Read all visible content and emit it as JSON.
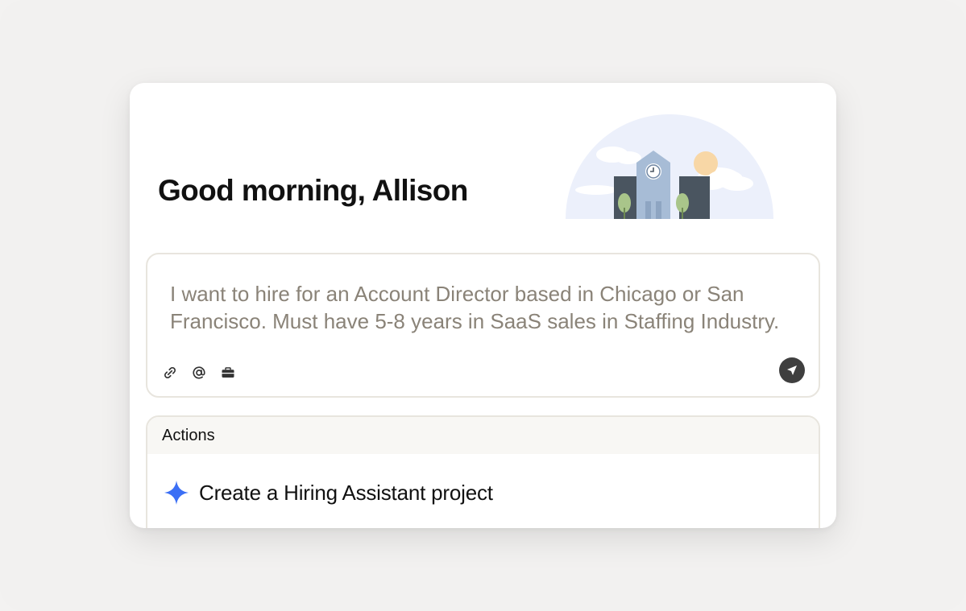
{
  "greeting": "Good morning, Allison",
  "prompt": {
    "text": "I want to hire for an Account Director based in Chicago or San Francisco. Must have 5-8 years in SaaS sales in Staffing Industry."
  },
  "toolbar": {
    "icons": [
      "paperclip-icon",
      "at-mention-icon",
      "briefcase-icon"
    ],
    "send_icon": "send-icon"
  },
  "actions": {
    "header": "Actions",
    "items": [
      {
        "label": "Create a Hiring Assistant project",
        "icon": "sparkle-icon",
        "icon_color": "#3b6ff5"
      }
    ]
  },
  "colors": {
    "card_bg": "#ffffff",
    "page_bg": "#f2f1f0",
    "placeholder_text": "#8a8378",
    "accent_sparkle": "#3b6ff5"
  }
}
